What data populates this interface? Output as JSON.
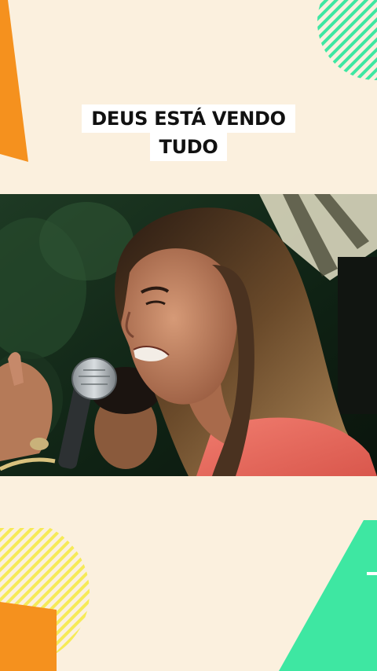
{
  "caption": {
    "line1": "DEUS ESTÁ VENDO",
    "line2": "TUDO"
  },
  "colors": {
    "background": "#fbf0de",
    "accent_orange": "#f5911e",
    "accent_green": "#3ee7a2",
    "accent_yellow": "#f6ea58",
    "caption_bg": "#ffffff",
    "caption_text": "#111111"
  },
  "video": {
    "scene": "woman-singing-into-microphone"
  }
}
